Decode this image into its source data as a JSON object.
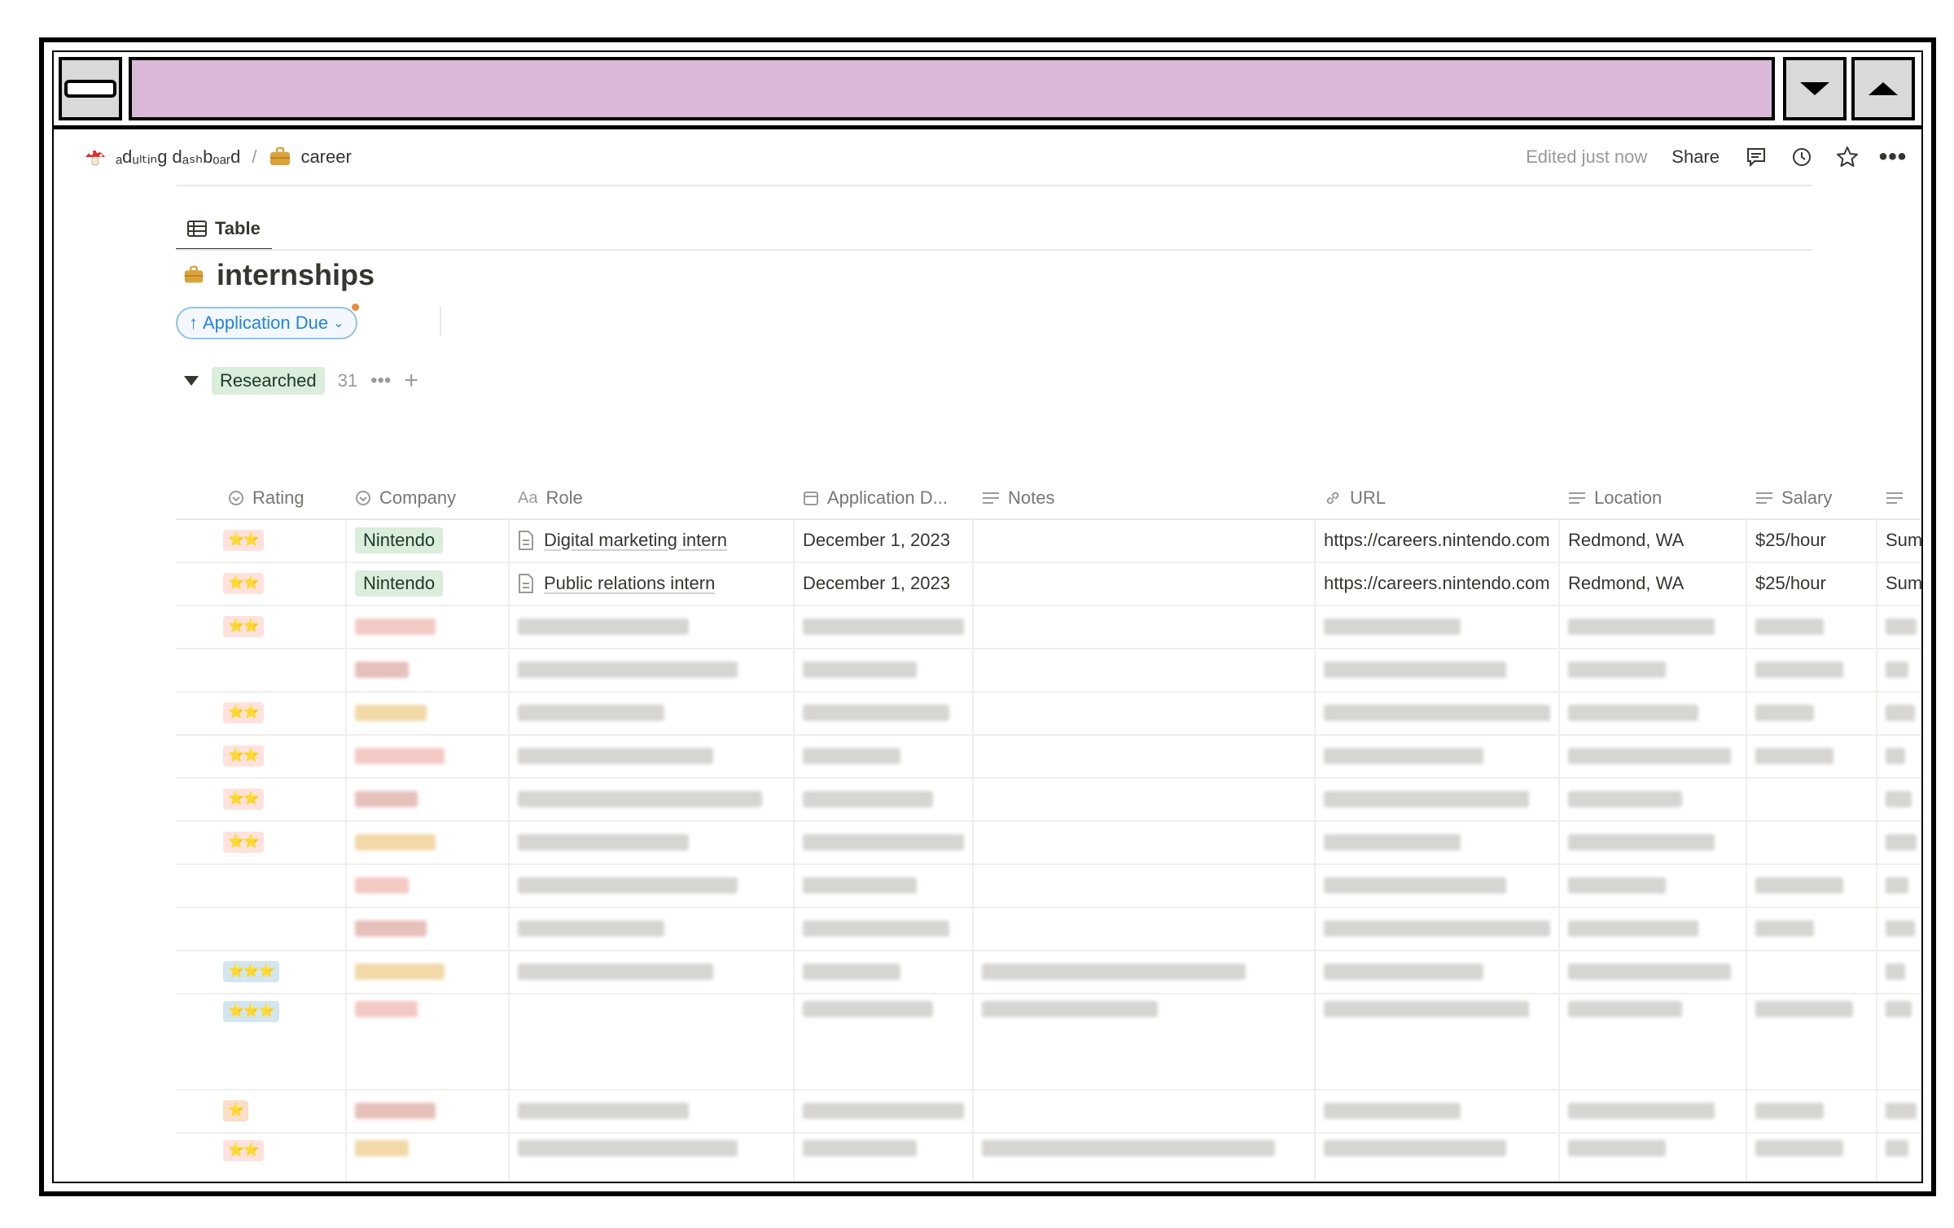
{
  "window": {
    "title_color": "#d9b9d7"
  },
  "breadcrumb": {
    "workspace": "ₐdᵤₗₜᵢₙg dₐₛₕbₒₐᵣd",
    "workspace_icon": "mushroom-icon",
    "separator": "/",
    "page": "career",
    "page_icon": "briefcase-icon"
  },
  "topbar": {
    "edited": "Edited just now",
    "share": "Share"
  },
  "view": {
    "tab_label": "Table",
    "title": "internships",
    "sort_label": "Application Due"
  },
  "group": {
    "label": "Researched",
    "count": "31"
  },
  "columns": [
    {
      "key": "rating",
      "label": "Rating",
      "icon": "status-icon"
    },
    {
      "key": "company",
      "label": "Company",
      "icon": "status-icon"
    },
    {
      "key": "role",
      "label": "Role",
      "icon": "text-aa-icon"
    },
    {
      "key": "application_due",
      "label": "Application D...",
      "icon": "calendar-icon"
    },
    {
      "key": "notes",
      "label": "Notes",
      "icon": "lines-icon"
    },
    {
      "key": "url",
      "label": "URL",
      "icon": "link-icon"
    },
    {
      "key": "location",
      "label": "Location",
      "icon": "lines-icon"
    },
    {
      "key": "salary",
      "label": "Salary",
      "icon": "lines-icon"
    }
  ],
  "rows": [
    {
      "rating": "⭐⭐",
      "company": "Nintendo",
      "role": "Digital marketing intern",
      "application_due": "December 1, 2023",
      "notes": "",
      "url": "https://careers.nintendo.com",
      "location": "Redmond, WA",
      "salary": "$25/hour",
      "extra": "Sum"
    },
    {
      "rating": "⭐⭐",
      "company": "Nintendo",
      "role": "Public relations intern",
      "application_due": "December 1, 2023",
      "notes": "",
      "url": "https://careers.nintendo.com",
      "location": "Redmond, WA",
      "salary": "$25/hour",
      "extra": "Sum"
    }
  ],
  "blurred_rows_ratings": [
    "⭐⭐",
    "",
    "⭐⭐",
    "⭐⭐",
    "⭐⭐",
    "⭐⭐",
    "",
    "",
    "⭐⭐⭐",
    "⭐⭐⭐",
    "⭐",
    "⭐⭐"
  ],
  "colors": {
    "accent": "#2383e2",
    "tag_green": "#dbeddb",
    "tag_red": "#ffe2dd",
    "tag_blue": "#d3e5ef",
    "tag_orange": "#fadec9"
  }
}
